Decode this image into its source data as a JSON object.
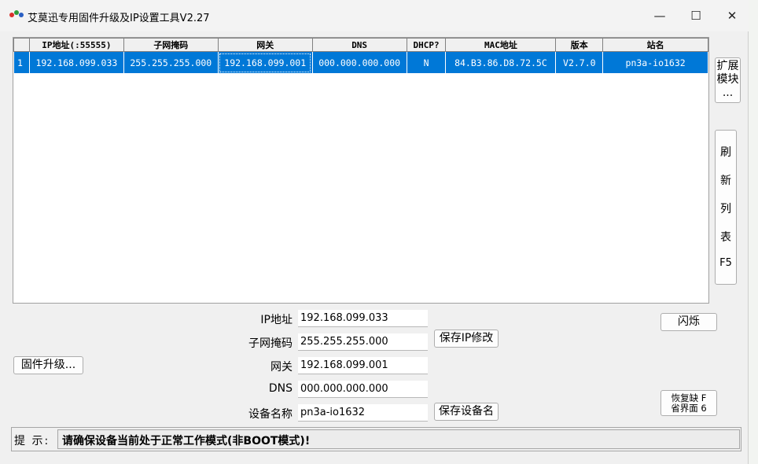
{
  "window": {
    "title": "艾莫迅专用固件升级及IP设置工具V2.27",
    "minimize_glyph": "—",
    "maximize_glyph": "☐",
    "close_glyph": "✕",
    "icon": "app-dots-icon"
  },
  "table": {
    "columns": [
      "",
      "IP地址(:55555)",
      "子网掩码",
      "网关",
      "DNS",
      "DHCP?",
      "MAC地址",
      "版本",
      "站名"
    ],
    "rows": [
      [
        "1",
        "192.168.099.033",
        "255.255.255.000",
        "192.168.099.001",
        "000.000.000.000",
        "N",
        "84.B3.86.D8.72.5C",
        "V2.7.0",
        "pn3a-io1632"
      ]
    ]
  },
  "side": {
    "ext_label_1": "扩展",
    "ext_label_2": "模块",
    "ext_label_3": "...",
    "refresh_chars": [
      "刷",
      "新",
      "列",
      "表",
      "F5"
    ]
  },
  "form": {
    "ip_label": "IP地址",
    "ip_value": "192.168.099.033",
    "mask_label": "子网掩码",
    "mask_value": "255.255.255.000",
    "gateway_label": "网关",
    "gateway_value": "192.168.099.001",
    "dns_label": "DNS",
    "dns_value": "000.000.000.000",
    "name_label": "设备名称",
    "name_value": "pn3a-io1632"
  },
  "buttons": {
    "firmware": "固件升级...",
    "save_ip": "保存IP修改",
    "save_name": "保存设备名",
    "blink": "闪烁",
    "restore_1": "恢复缺 F",
    "restore_2": "省界面 6"
  },
  "status": {
    "label": "提 示:",
    "message": "请确保设备当前处于正常工作模式(非BOOT模式)!"
  },
  "colors": {
    "selection": "#0078d7",
    "window_bg": "#f0f0f0"
  }
}
